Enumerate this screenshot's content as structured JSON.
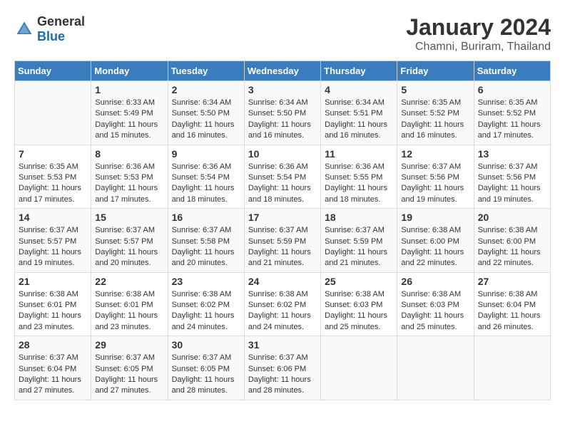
{
  "logo": {
    "general": "General",
    "blue": "Blue"
  },
  "title": "January 2024",
  "location": "Chamni, Buriram, Thailand",
  "days_of_week": [
    "Sunday",
    "Monday",
    "Tuesday",
    "Wednesday",
    "Thursday",
    "Friday",
    "Saturday"
  ],
  "weeks": [
    [
      {
        "day": "",
        "sunrise": "",
        "sunset": "",
        "daylight": ""
      },
      {
        "day": "1",
        "sunrise": "Sunrise: 6:33 AM",
        "sunset": "Sunset: 5:49 PM",
        "daylight": "Daylight: 11 hours and 15 minutes."
      },
      {
        "day": "2",
        "sunrise": "Sunrise: 6:34 AM",
        "sunset": "Sunset: 5:50 PM",
        "daylight": "Daylight: 11 hours and 16 minutes."
      },
      {
        "day": "3",
        "sunrise": "Sunrise: 6:34 AM",
        "sunset": "Sunset: 5:50 PM",
        "daylight": "Daylight: 11 hours and 16 minutes."
      },
      {
        "day": "4",
        "sunrise": "Sunrise: 6:34 AM",
        "sunset": "Sunset: 5:51 PM",
        "daylight": "Daylight: 11 hours and 16 minutes."
      },
      {
        "day": "5",
        "sunrise": "Sunrise: 6:35 AM",
        "sunset": "Sunset: 5:52 PM",
        "daylight": "Daylight: 11 hours and 16 minutes."
      },
      {
        "day": "6",
        "sunrise": "Sunrise: 6:35 AM",
        "sunset": "Sunset: 5:52 PM",
        "daylight": "Daylight: 11 hours and 17 minutes."
      }
    ],
    [
      {
        "day": "7",
        "sunrise": "Sunrise: 6:35 AM",
        "sunset": "Sunset: 5:53 PM",
        "daylight": "Daylight: 11 hours and 17 minutes."
      },
      {
        "day": "8",
        "sunrise": "Sunrise: 6:36 AM",
        "sunset": "Sunset: 5:53 PM",
        "daylight": "Daylight: 11 hours and 17 minutes."
      },
      {
        "day": "9",
        "sunrise": "Sunrise: 6:36 AM",
        "sunset": "Sunset: 5:54 PM",
        "daylight": "Daylight: 11 hours and 18 minutes."
      },
      {
        "day": "10",
        "sunrise": "Sunrise: 6:36 AM",
        "sunset": "Sunset: 5:54 PM",
        "daylight": "Daylight: 11 hours and 18 minutes."
      },
      {
        "day": "11",
        "sunrise": "Sunrise: 6:36 AM",
        "sunset": "Sunset: 5:55 PM",
        "daylight": "Daylight: 11 hours and 18 minutes."
      },
      {
        "day": "12",
        "sunrise": "Sunrise: 6:37 AM",
        "sunset": "Sunset: 5:56 PM",
        "daylight": "Daylight: 11 hours and 19 minutes."
      },
      {
        "day": "13",
        "sunrise": "Sunrise: 6:37 AM",
        "sunset": "Sunset: 5:56 PM",
        "daylight": "Daylight: 11 hours and 19 minutes."
      }
    ],
    [
      {
        "day": "14",
        "sunrise": "Sunrise: 6:37 AM",
        "sunset": "Sunset: 5:57 PM",
        "daylight": "Daylight: 11 hours and 19 minutes."
      },
      {
        "day": "15",
        "sunrise": "Sunrise: 6:37 AM",
        "sunset": "Sunset: 5:57 PM",
        "daylight": "Daylight: 11 hours and 20 minutes."
      },
      {
        "day": "16",
        "sunrise": "Sunrise: 6:37 AM",
        "sunset": "Sunset: 5:58 PM",
        "daylight": "Daylight: 11 hours and 20 minutes."
      },
      {
        "day": "17",
        "sunrise": "Sunrise: 6:37 AM",
        "sunset": "Sunset: 5:59 PM",
        "daylight": "Daylight: 11 hours and 21 minutes."
      },
      {
        "day": "18",
        "sunrise": "Sunrise: 6:37 AM",
        "sunset": "Sunset: 5:59 PM",
        "daylight": "Daylight: 11 hours and 21 minutes."
      },
      {
        "day": "19",
        "sunrise": "Sunrise: 6:38 AM",
        "sunset": "Sunset: 6:00 PM",
        "daylight": "Daylight: 11 hours and 22 minutes."
      },
      {
        "day": "20",
        "sunrise": "Sunrise: 6:38 AM",
        "sunset": "Sunset: 6:00 PM",
        "daylight": "Daylight: 11 hours and 22 minutes."
      }
    ],
    [
      {
        "day": "21",
        "sunrise": "Sunrise: 6:38 AM",
        "sunset": "Sunset: 6:01 PM",
        "daylight": "Daylight: 11 hours and 23 minutes."
      },
      {
        "day": "22",
        "sunrise": "Sunrise: 6:38 AM",
        "sunset": "Sunset: 6:01 PM",
        "daylight": "Daylight: 11 hours and 23 minutes."
      },
      {
        "day": "23",
        "sunrise": "Sunrise: 6:38 AM",
        "sunset": "Sunset: 6:02 PM",
        "daylight": "Daylight: 11 hours and 24 minutes."
      },
      {
        "day": "24",
        "sunrise": "Sunrise: 6:38 AM",
        "sunset": "Sunset: 6:02 PM",
        "daylight": "Daylight: 11 hours and 24 minutes."
      },
      {
        "day": "25",
        "sunrise": "Sunrise: 6:38 AM",
        "sunset": "Sunset: 6:03 PM",
        "daylight": "Daylight: 11 hours and 25 minutes."
      },
      {
        "day": "26",
        "sunrise": "Sunrise: 6:38 AM",
        "sunset": "Sunset: 6:03 PM",
        "daylight": "Daylight: 11 hours and 25 minutes."
      },
      {
        "day": "27",
        "sunrise": "Sunrise: 6:38 AM",
        "sunset": "Sunset: 6:04 PM",
        "daylight": "Daylight: 11 hours and 26 minutes."
      }
    ],
    [
      {
        "day": "28",
        "sunrise": "Sunrise: 6:37 AM",
        "sunset": "Sunset: 6:04 PM",
        "daylight": "Daylight: 11 hours and 27 minutes."
      },
      {
        "day": "29",
        "sunrise": "Sunrise: 6:37 AM",
        "sunset": "Sunset: 6:05 PM",
        "daylight": "Daylight: 11 hours and 27 minutes."
      },
      {
        "day": "30",
        "sunrise": "Sunrise: 6:37 AM",
        "sunset": "Sunset: 6:05 PM",
        "daylight": "Daylight: 11 hours and 28 minutes."
      },
      {
        "day": "31",
        "sunrise": "Sunrise: 6:37 AM",
        "sunset": "Sunset: 6:06 PM",
        "daylight": "Daylight: 11 hours and 28 minutes."
      },
      {
        "day": "",
        "sunrise": "",
        "sunset": "",
        "daylight": ""
      },
      {
        "day": "",
        "sunrise": "",
        "sunset": "",
        "daylight": ""
      },
      {
        "day": "",
        "sunrise": "",
        "sunset": "",
        "daylight": ""
      }
    ]
  ]
}
